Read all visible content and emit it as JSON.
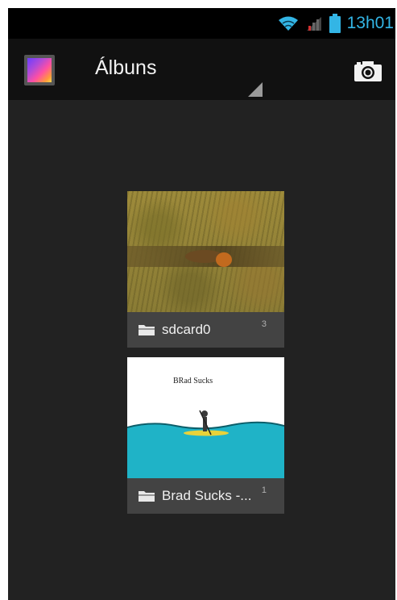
{
  "status_bar": {
    "time": "13h01",
    "icons": [
      "wifi-icon",
      "signal-icon",
      "battery-icon"
    ],
    "time_color": "#33b5e5"
  },
  "action_bar": {
    "title": "Álbuns",
    "icons": [
      "gallery-app-icon",
      "camera-icon"
    ]
  },
  "albums": [
    {
      "name": "sdcard0",
      "count": "3",
      "thumbnail": "lion-in-grass"
    },
    {
      "name": "Brad Sucks -...",
      "count": "1",
      "thumbnail": "album-cover-boat"
    }
  ],
  "album_art": {
    "caption": "BRad Sucks"
  },
  "colors": {
    "background": "#222222",
    "action_bar": "#111111",
    "label_strip": "#434343",
    "accent": "#33b5e5",
    "water": "#1fb3c7"
  }
}
